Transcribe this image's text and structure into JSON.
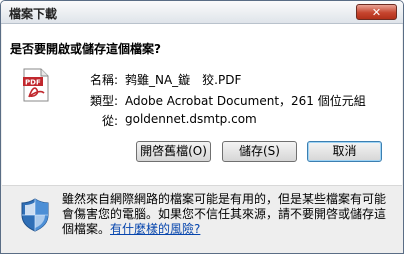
{
  "window": {
    "title": "檔案下載",
    "close_label": "✕"
  },
  "dialog": {
    "question": "是否要開啟或儲存這個檔案?",
    "file_icon_text": "PDF",
    "fields": [
      {
        "label": "名稱:",
        "value": "鹁雖_NA_鏇　狡.PDF"
      },
      {
        "label": "類型:",
        "value": "Adobe Acrobat Document，261 個位元組"
      },
      {
        "label": "從:",
        "value": "goldennet.dsmtp.com"
      }
    ]
  },
  "buttons": {
    "open": "開啓舊檔(O)",
    "save": "儲存(S)",
    "cancel": "取消"
  },
  "warning": {
    "text": "雖然來自網際網路的檔案可能是有用的，但是某些檔案有可能會傷害您的電腦。如果您不信任其來源，請不要開啓或儲存這個檔案。",
    "link": "有什麼樣的風險?"
  }
}
